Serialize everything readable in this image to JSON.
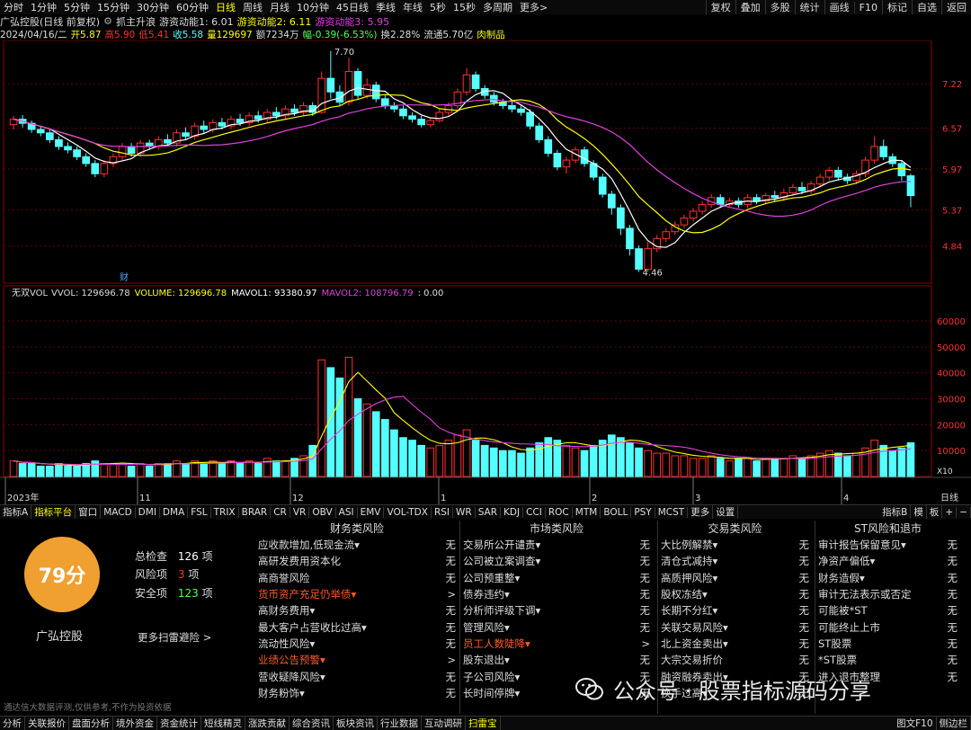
{
  "toolbar": {
    "timeframes": [
      "分时",
      "1分钟",
      "5分钟",
      "15分钟",
      "30分钟",
      "60分钟",
      "日线",
      "周线",
      "月线",
      "10分钟",
      "45日线",
      "季线",
      "年线",
      "5秒",
      "15秒",
      "多周期",
      "更多>"
    ],
    "active_timeframe": "日线",
    "right_buttons": [
      "复权",
      "叠加",
      "多股",
      "统计",
      "画线",
      "F10",
      "标记",
      "自选",
      "返回"
    ]
  },
  "info": {
    "stock": "广弘控股(日线 前复权)",
    "ind1": "抓主升浪",
    "ind2": "游资动能1: 6.01",
    "ind3": "游资动能2: 6.11",
    "ind4": "游资动能3: 5.95"
  },
  "quote": {
    "date": "2024/04/16/二",
    "open": "开5.87",
    "high": "高5.90",
    "low": "低5.41",
    "close": "收5.58",
    "volume": "量129697",
    "amount": "额7234万",
    "change": "幅-0.39(-6.53%)",
    "turnover": "换2.28%",
    "float": "流通5.70亿",
    "sector": "肉制品"
  },
  "main_chart": {
    "price_ticks": [
      "7.22",
      "6.57",
      "5.97",
      "5.37",
      "4.84"
    ],
    "high_label": "7.70",
    "low_label": "4.46",
    "cai_label": "财"
  },
  "volume_chart": {
    "legend_name": "无双VOL",
    "vvol": "VVOL: 129696.78",
    "volume": "VOLUME: 129696.78",
    "mavol1": "MAVOL1: 93380.97",
    "mavol2": "MAVOL2: 108796.79",
    "extra": ": 0.00",
    "ticks": [
      "60000",
      "50000",
      "40000",
      "30000",
      "20000",
      "10000"
    ],
    "multiplier": "X10"
  },
  "time_axis": [
    "2023年",
    "11",
    "12",
    "1",
    "2",
    "3",
    "4"
  ],
  "time_axis_right": "日线",
  "tabs": [
    "指标A",
    "指标平台",
    "窗口",
    "MACD",
    "DMI",
    "DMA",
    "FSL",
    "TRIX",
    "BRAR",
    "CR",
    "VR",
    "OBV",
    "ASI",
    "EMV",
    "VOL-TDX",
    "RSI",
    "WR",
    "SAR",
    "KDJ",
    "CCI",
    "ROC",
    "MTM",
    "BOLL",
    "PSY",
    "MCST",
    "更多",
    "设置"
  ],
  "active_tab": "指标平台",
  "tabs_right": [
    "指标B",
    "模",
    "板",
    "+",
    "−"
  ],
  "risk": {
    "score": "79分",
    "company": "广弘控股",
    "total_label": "总检查",
    "total_value": "126",
    "unit": "项",
    "risk_label": "风险项",
    "risk_value": "3",
    "safe_label": "安全项",
    "safe_value": "123",
    "more": "更多扫雷避险 >",
    "columns": [
      {
        "title": "财务类风险",
        "items": [
          {
            "label": "应收款增加,低现金流▾",
            "value": "无",
            "hl": false
          },
          {
            "label": "高研发费用资本化",
            "value": "无",
            "hl": false
          },
          {
            "label": "高商誉风险",
            "value": "无",
            "hl": false
          },
          {
            "label": "货币资产充足仍举债▾",
            "value": ">",
            "hl": true
          },
          {
            "label": "高财务费用▾",
            "value": "无",
            "hl": false
          },
          {
            "label": "最大客户占营收比过高▾",
            "value": "无",
            "hl": false
          },
          {
            "label": "流动性风险▾",
            "value": "无",
            "hl": false
          },
          {
            "label": "业绩公告预警▾",
            "value": ">",
            "hl": true
          },
          {
            "label": "营收疑降风险▾",
            "value": "无",
            "hl": false
          },
          {
            "label": "财务粉饰▾",
            "value": "无",
            "hl": false
          }
        ]
      },
      {
        "title": "市场类风险",
        "items": [
          {
            "label": "交易所公开谴责▾",
            "value": "无",
            "hl": false
          },
          {
            "label": "公司被立案调查▾",
            "value": "无",
            "hl": false
          },
          {
            "label": "公司预重整▾",
            "value": "无",
            "hl": false
          },
          {
            "label": "债券违约▾",
            "value": "无",
            "hl": false
          },
          {
            "label": "分析师评级下调▾",
            "value": "无",
            "hl": false
          },
          {
            "label": "管理风险▾",
            "value": "无",
            "hl": false
          },
          {
            "label": "员工人数陡降▾",
            "value": ">",
            "hl": true
          },
          {
            "label": "股东退出▾",
            "value": "无",
            "hl": false
          },
          {
            "label": "子公司风险▾",
            "value": "无",
            "hl": false
          },
          {
            "label": "长时间停牌▾",
            "value": "无",
            "hl": false
          }
        ]
      },
      {
        "title": "交易类风险",
        "items": [
          {
            "label": "大比例解禁▾",
            "value": "无",
            "hl": false
          },
          {
            "label": "清仓式减持▾",
            "value": "无",
            "hl": false
          },
          {
            "label": "高质押风险▾",
            "value": "无",
            "hl": false
          },
          {
            "label": "股权冻结▾",
            "value": "无",
            "hl": false
          },
          {
            "label": "长期不分红▾",
            "value": "无",
            "hl": false
          },
          {
            "label": "关联交易风险▾",
            "value": "无",
            "hl": false
          },
          {
            "label": "北上资金卖出▾",
            "value": "无",
            "hl": false
          },
          {
            "label": "大宗交易折价",
            "value": "无",
            "hl": false
          },
          {
            "label": "融资融券卖出▾",
            "value": "无",
            "hl": false
          },
          {
            "label": "换手过高▾",
            "value": "无",
            "hl": false
          }
        ]
      },
      {
        "title": "ST风险和退市",
        "items": [
          {
            "label": "审计报告保留意见▾",
            "value": "无",
            "hl": false
          },
          {
            "label": "净资产偏低▾",
            "value": "无",
            "hl": false
          },
          {
            "label": "财务造假▾",
            "value": "无",
            "hl": false
          },
          {
            "label": "审计无法表示或否定",
            "value": "无",
            "hl": false
          },
          {
            "label": "可能被*ST",
            "value": "无",
            "hl": false
          },
          {
            "label": "可能终止上市",
            "value": "无",
            "hl": false
          },
          {
            "label": "ST股票",
            "value": "无",
            "hl": false
          },
          {
            "label": "*ST股票",
            "value": "无",
            "hl": false
          },
          {
            "label": "进入退市整理",
            "value": "无",
            "hl": false
          }
        ]
      }
    ],
    "disclaimer": "通达信大数据评测,仅供参考,不作为投资依据",
    "watermark": "公众号 · 股票指标源码分享"
  },
  "statusbar": {
    "items": [
      "分析",
      "关联报价",
      "盘面分析",
      "境外资金",
      "资金统计",
      "短线精灵",
      "涨跌贡献",
      "综合资讯",
      "板块资讯",
      "行业数据",
      "互动调研",
      "扫雷宝"
    ],
    "active": "扫雷宝",
    "right": [
      "图文F10",
      "侧边栏"
    ]
  },
  "colors": {
    "up": "#ff3030",
    "down": "#54ffff",
    "ma1": "#ffff00",
    "ma2": "#e040e0",
    "ma3": "#ffffff",
    "grid": "#600000"
  },
  "candles": [
    [
      6.62,
      6.7,
      6.75,
      6.55
    ],
    [
      6.7,
      6.64,
      6.76,
      6.58
    ],
    [
      6.64,
      6.55,
      6.68,
      6.5
    ],
    [
      6.55,
      6.5,
      6.6,
      6.45
    ],
    [
      6.5,
      6.4,
      6.55,
      6.35
    ],
    [
      6.4,
      6.3,
      6.45,
      6.25
    ],
    [
      6.3,
      6.25,
      6.36,
      6.2
    ],
    [
      6.25,
      6.15,
      6.3,
      6.1
    ],
    [
      6.15,
      6.05,
      6.2,
      6.0
    ],
    [
      6.05,
      5.9,
      6.1,
      5.85
    ],
    [
      5.9,
      6.05,
      6.1,
      5.85
    ],
    [
      6.05,
      6.15,
      6.2,
      6.0
    ],
    [
      6.15,
      6.3,
      6.35,
      6.1
    ],
    [
      6.3,
      6.2,
      6.35,
      6.15
    ],
    [
      6.2,
      6.35,
      6.4,
      6.15
    ],
    [
      6.35,
      6.3,
      6.4,
      6.25
    ],
    [
      6.3,
      6.4,
      6.45,
      6.25
    ],
    [
      6.4,
      6.35,
      6.48,
      6.3
    ],
    [
      6.35,
      6.5,
      6.55,
      6.3
    ],
    [
      6.5,
      6.45,
      6.58,
      6.4
    ],
    [
      6.45,
      6.6,
      6.65,
      6.4
    ],
    [
      6.6,
      6.55,
      6.68,
      6.5
    ],
    [
      6.55,
      6.65,
      6.7,
      6.5
    ],
    [
      6.65,
      6.6,
      6.72,
      6.55
    ],
    [
      6.6,
      6.7,
      6.75,
      6.55
    ],
    [
      6.7,
      6.65,
      6.78,
      6.6
    ],
    [
      6.65,
      6.75,
      6.8,
      6.6
    ],
    [
      6.75,
      6.7,
      6.82,
      6.65
    ],
    [
      6.7,
      6.8,
      6.85,
      6.65
    ],
    [
      6.8,
      6.75,
      6.88,
      6.7
    ],
    [
      6.75,
      6.85,
      6.9,
      6.7
    ],
    [
      6.85,
      6.8,
      6.92,
      6.75
    ],
    [
      6.8,
      6.9,
      6.95,
      6.75
    ],
    [
      6.9,
      6.8,
      6.95,
      6.75
    ],
    [
      6.8,
      7.3,
      7.4,
      6.78
    ],
    [
      7.3,
      7.1,
      7.7,
      7.0
    ],
    [
      7.1,
      6.95,
      7.2,
      6.9
    ],
    [
      6.95,
      7.4,
      7.6,
      6.9
    ],
    [
      7.4,
      7.05,
      7.45,
      7.0
    ],
    [
      7.05,
      7.2,
      7.3,
      7.0
    ],
    [
      7.2,
      7.0,
      7.25,
      6.95
    ],
    [
      7.0,
      6.9,
      7.05,
      6.85
    ],
    [
      6.9,
      6.85,
      6.95,
      6.8
    ],
    [
      6.85,
      6.75,
      6.9,
      6.7
    ],
    [
      6.75,
      6.7,
      6.8,
      6.65
    ],
    [
      6.7,
      6.62,
      6.75,
      6.58
    ],
    [
      6.62,
      6.68,
      6.72,
      6.58
    ],
    [
      6.68,
      6.8,
      6.85,
      6.65
    ],
    [
      6.8,
      6.9,
      6.95,
      6.75
    ],
    [
      6.9,
      7.1,
      7.15,
      6.85
    ],
    [
      7.1,
      7.35,
      7.45,
      7.05
    ],
    [
      7.35,
      7.15,
      7.4,
      7.1
    ],
    [
      7.15,
      7.05,
      7.2,
      7.0
    ],
    [
      7.05,
      6.95,
      7.1,
      6.9
    ],
    [
      6.95,
      6.9,
      7.0,
      6.85
    ],
    [
      6.9,
      6.85,
      6.95,
      6.8
    ],
    [
      6.85,
      6.8,
      6.9,
      6.75
    ],
    [
      6.8,
      6.6,
      6.85,
      6.55
    ],
    [
      6.6,
      6.4,
      6.65,
      6.35
    ],
    [
      6.4,
      6.2,
      6.45,
      6.15
    ],
    [
      6.2,
      6.0,
      6.25,
      5.95
    ],
    [
      6.0,
      6.1,
      6.15,
      5.9
    ],
    [
      6.1,
      6.25,
      6.3,
      6.05
    ],
    [
      6.25,
      6.05,
      6.3,
      6.0
    ],
    [
      6.05,
      5.85,
      6.1,
      5.8
    ],
    [
      5.85,
      5.6,
      5.9,
      5.55
    ],
    [
      5.6,
      5.4,
      5.65,
      5.3
    ],
    [
      5.4,
      5.1,
      5.45,
      5.0
    ],
    [
      5.1,
      4.8,
      5.15,
      4.7
    ],
    [
      4.8,
      4.5,
      4.85,
      4.46
    ],
    [
      4.5,
      4.8,
      4.9,
      4.46
    ],
    [
      4.8,
      4.95,
      5.0,
      4.75
    ],
    [
      4.95,
      5.05,
      5.1,
      4.9
    ],
    [
      5.05,
      5.15,
      5.2,
      5.0
    ],
    [
      5.15,
      5.25,
      5.3,
      5.1
    ],
    [
      5.25,
      5.35,
      5.4,
      5.2
    ],
    [
      5.35,
      5.45,
      5.5,
      5.3
    ],
    [
      5.45,
      5.55,
      5.6,
      5.4
    ],
    [
      5.55,
      5.45,
      5.6,
      5.4
    ],
    [
      5.45,
      5.5,
      5.55,
      5.4
    ],
    [
      5.5,
      5.45,
      5.55,
      5.4
    ],
    [
      5.45,
      5.55,
      5.6,
      5.4
    ],
    [
      5.55,
      5.5,
      5.6,
      5.45
    ],
    [
      5.5,
      5.58,
      5.62,
      5.45
    ],
    [
      5.58,
      5.55,
      5.65,
      5.5
    ],
    [
      5.55,
      5.62,
      5.68,
      5.5
    ],
    [
      5.62,
      5.7,
      5.75,
      5.58
    ],
    [
      5.7,
      5.65,
      5.78,
      5.6
    ],
    [
      5.65,
      5.75,
      5.8,
      5.6
    ],
    [
      5.75,
      5.85,
      5.9,
      5.7
    ],
    [
      5.85,
      5.95,
      6.0,
      5.8
    ],
    [
      5.95,
      5.85,
      6.0,
      5.8
    ],
    [
      5.85,
      5.8,
      5.9,
      5.75
    ],
    [
      5.8,
      5.9,
      5.95,
      5.75
    ],
    [
      5.9,
      6.1,
      6.15,
      5.85
    ],
    [
      6.1,
      6.3,
      6.45,
      6.05
    ],
    [
      6.3,
      6.15,
      6.4,
      6.1
    ],
    [
      6.15,
      6.05,
      6.2,
      6.0
    ],
    [
      6.05,
      5.87,
      6.1,
      5.8
    ],
    [
      5.87,
      5.58,
      5.9,
      5.41
    ]
  ],
  "volumes": [
    6,
    5,
    5,
    4,
    4,
    5,
    4,
    4,
    5,
    6,
    5,
    5,
    5,
    4,
    5,
    4,
    5,
    5,
    6,
    5,
    6,
    5,
    6,
    5,
    6,
    5,
    6,
    5,
    7,
    6,
    6,
    7,
    8,
    12,
    45,
    42,
    38,
    46,
    30,
    28,
    25,
    22,
    18,
    15,
    14,
    12,
    11,
    12,
    14,
    16,
    18,
    14,
    12,
    11,
    10,
    10,
    9,
    11,
    13,
    15,
    14,
    12,
    11,
    10,
    12,
    14,
    16,
    15,
    13,
    11,
    10,
    9,
    9,
    8,
    8,
    7,
    7,
    8,
    7,
    6,
    7,
    7,
    6,
    7,
    7,
    7,
    8,
    7,
    8,
    9,
    10,
    9,
    8,
    9,
    11,
    14,
    12,
    10,
    11,
    13
  ],
  "vol_peaks": [
    [
      10,
      19
    ],
    [
      23,
      8
    ],
    [
      50,
      55
    ],
    [
      84,
      52
    ],
    [
      217,
      30
    ]
  ]
}
